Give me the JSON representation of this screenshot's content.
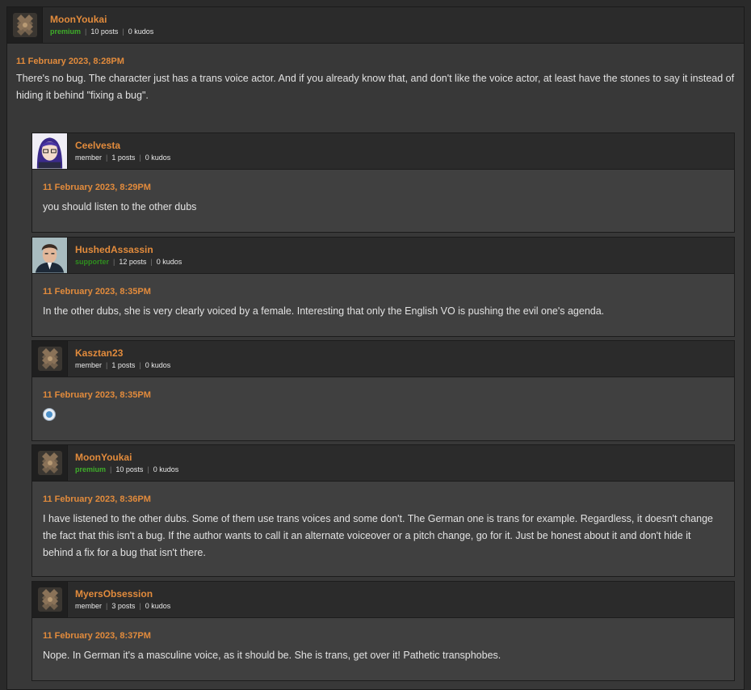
{
  "colors": {
    "accent_orange": "#e28b3c",
    "premium_green": "#3fae2a",
    "supporter_green": "#2f8f1e",
    "panel_bg": "#383838",
    "reply_bg": "#404040"
  },
  "main_post": {
    "avatar_icon": "default-avatar-icon",
    "username": "MoonYoukai",
    "role": "premium",
    "posts": "10 posts",
    "kudos": "0 kudos",
    "date": "11 February 2023, 8:28PM",
    "text": "There's no bug. The character just has a trans voice actor. And if you already know that, and don't like the voice actor, at least have the stones to say it instead of hiding it behind \"fixing a bug\"."
  },
  "replies": [
    {
      "avatar_icon": "anime-girl-avatar-icon",
      "username": "Ceelvesta",
      "role": "member",
      "posts": "1 posts",
      "kudos": "0 kudos",
      "date": "11 February 2023, 8:29PM",
      "text": "you should listen to the other dubs"
    },
    {
      "avatar_icon": "man-portrait-avatar-icon",
      "username": "HushedAssassin",
      "role": "supporter",
      "posts": "12 posts",
      "kudos": "0 kudos",
      "date": "11 February 2023, 8:35PM",
      "text": "In the other dubs, she is very clearly voiced by a female. Interesting that only the English VO is pushing the evil one's agenda."
    },
    {
      "avatar_icon": "default-avatar-icon",
      "username": "Kasztan23",
      "role": "member",
      "posts": "1 posts",
      "kudos": "0 kudos",
      "date": "11 February 2023, 8:35PM",
      "emoji": "emoji-icon"
    },
    {
      "avatar_icon": "default-avatar-icon",
      "username": "MoonYoukai",
      "role": "premium",
      "posts": "10 posts",
      "kudos": "0 kudos",
      "date": "11 February 2023, 8:36PM",
      "text": "I have listened to the other dubs. Some of them use trans voices and some don't. The German one is trans for example. Regardless, it doesn't change the fact that this isn't a bug. If the author wants to call it an alternate voiceover or a pitch change, go for it. Just be honest about it and don't hide it behind a fix for a bug that isn't there."
    },
    {
      "avatar_icon": "default-avatar-icon",
      "username": "MyersObsession",
      "role": "member",
      "posts": "3 posts",
      "kudos": "0 kudos",
      "date": "11 February 2023, 8:37PM",
      "text": "Nope. In German it's a masculine voice, as it should be. She is trans, get over it! Pathetic transphobes."
    }
  ]
}
